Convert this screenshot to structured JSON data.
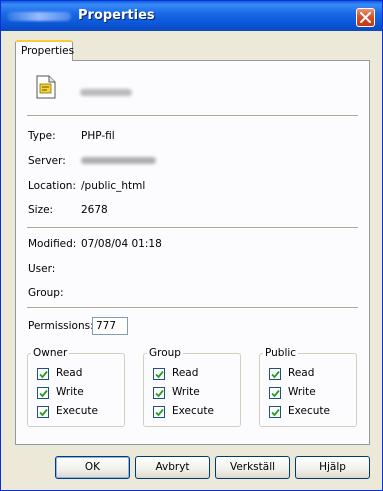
{
  "window": {
    "title": "Properties"
  },
  "tabs": [
    {
      "label": "Properties"
    }
  ],
  "info": {
    "type_label": "Type:",
    "type_value": "PHP-fil",
    "server_label": "Server:",
    "location_label": "Location:",
    "location_value": "/public_html",
    "size_label": "Size:",
    "size_value": "2678",
    "modified_label": "Modified:",
    "modified_value": "07/08/04 01:18",
    "user_label": "User:",
    "group_label": "Group:"
  },
  "permissions": {
    "label": "Permissions:",
    "value": "777"
  },
  "groups": [
    {
      "title": "Owner",
      "items": [
        {
          "label": "Read",
          "checked": true
        },
        {
          "label": "Write",
          "checked": true
        },
        {
          "label": "Execute",
          "checked": true
        }
      ]
    },
    {
      "title": "Group",
      "items": [
        {
          "label": "Read",
          "checked": true
        },
        {
          "label": "Write",
          "checked": true
        },
        {
          "label": "Execute",
          "checked": true
        }
      ]
    },
    {
      "title": "Public",
      "items": [
        {
          "label": "Read",
          "checked": true
        },
        {
          "label": "Write",
          "checked": true
        },
        {
          "label": "Execute",
          "checked": true
        }
      ]
    }
  ],
  "buttons": {
    "ok": "OK",
    "cancel": "Avbryt",
    "apply": "Verkställ",
    "help": "Hjälp"
  },
  "icons": {
    "file": "php-file-icon",
    "close": "close-icon",
    "check": "checkmark-icon"
  },
  "colors": {
    "titlebar": "#0b56d6",
    "dialog_bg": "#ece9d8",
    "panel_bg": "#fcfcfe",
    "close_button": "#d8502b"
  }
}
